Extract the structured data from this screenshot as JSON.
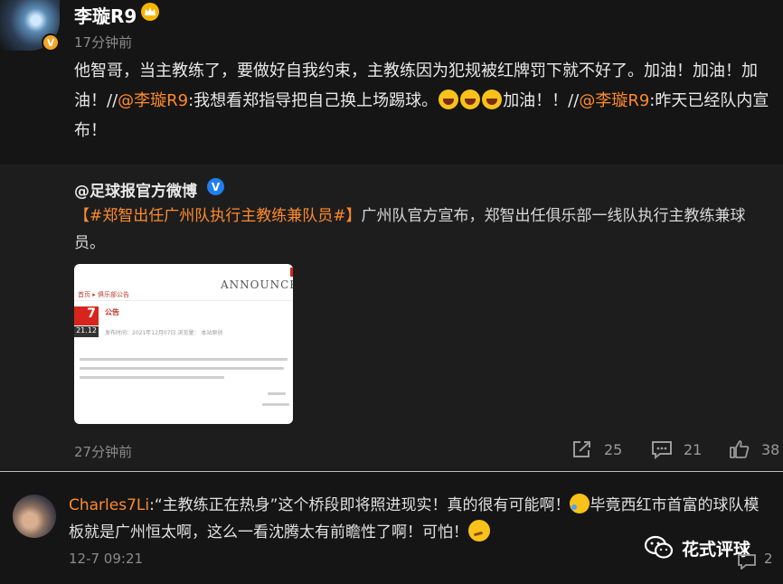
{
  "post": {
    "username": "李璇R9",
    "vip_badge": "V",
    "time": "17分钟前",
    "text_a": "他智哥，当主教练了，要做好自我约束，主教练因为犯规被红牌罚下就不好了。加油！加油！加油！//",
    "mention_a": "@李璇R9",
    "text_b": ":我想看郑指导把自己换上场踢球。",
    "text_c": "加油！！//",
    "mention_b": "@李璇R9",
    "text_d": ":昨天已经队内宣布！"
  },
  "repost": {
    "username": "@足球报官方微博",
    "verified_badge": "V",
    "topic": "【#郑智出任广州队执行主教练兼队员#】",
    "text": "广州队官方宣布，郑智出任俱乐部一线队执行主教练兼球员。",
    "thumbnail": {
      "title": "ANNOUNCEI",
      "crumb": "首页 ▸ 俱乐部公告",
      "day": "7",
      "date": "21.12",
      "heading": "公告",
      "meta": "发布时间：2021年12月07日  浏览量：  本站原创"
    },
    "time": "27分钟前",
    "share_count": "25",
    "comment_count": "21",
    "like_count": "38"
  },
  "comment": {
    "author": "Charles7Li",
    "text_a": ":“主教练正在热身”这个桥段即将照进现实！真的很有可能啊！",
    "text_b": "毕竟西红市首富的球队模板就是广州恒太啊，这么一看沈腾太有前瞻性了啊！可怕！",
    "time": "12-7 09:21",
    "comment_count": "2"
  },
  "watermark": {
    "text": "花式评球"
  },
  "colors": {
    "background": "#151515",
    "repost_bg": "#1d1d1d",
    "accent": "#ff8a2e",
    "muted": "#8a8a8a"
  }
}
